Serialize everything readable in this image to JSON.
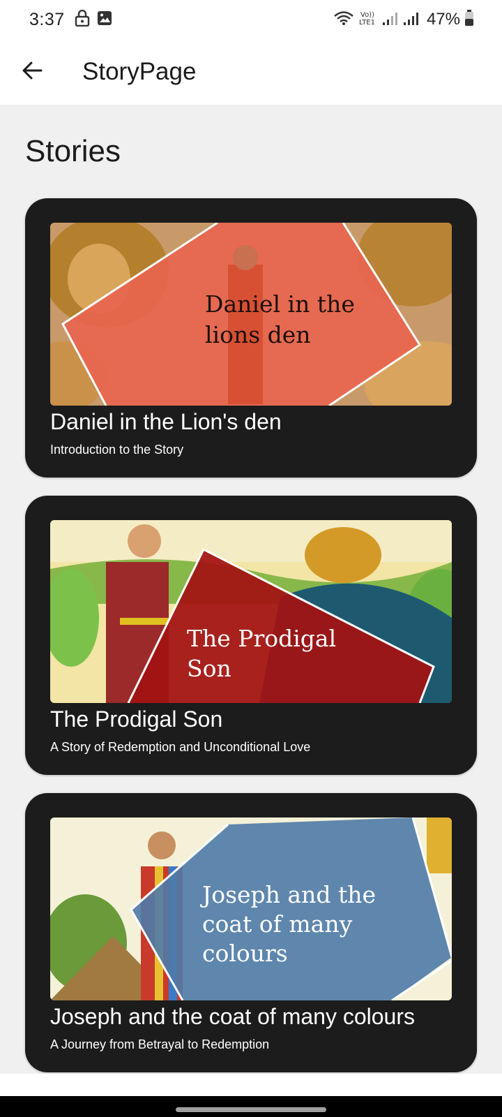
{
  "status_bar": {
    "time": "3:37",
    "battery": "47%",
    "icons": [
      "lock-icon",
      "image-icon",
      "wifi-icon",
      "volte-icon",
      "signal-icon",
      "battery-icon"
    ]
  },
  "app_bar": {
    "title": "StoryPage",
    "back_icon": "arrow-left-icon"
  },
  "section": {
    "title": "Stories"
  },
  "stories": [
    {
      "title": "Daniel in the Lion's den",
      "subtitle": "Introduction to the Story",
      "image_text_line1": "Daniel in the",
      "image_text_line2": "lions den",
      "accent": "#e8654f"
    },
    {
      "title": "The Prodigal Son",
      "subtitle": "A Story of Redemption and Unconditional Love",
      "image_text_line1": "The Prodigal",
      "image_text_line2": "Son",
      "accent": "#9e1414"
    },
    {
      "title": "Joseph and the coat of many colours",
      "subtitle": "A Journey from Betrayal to Redemption",
      "image_text_line1": "Joseph and the",
      "image_text_line2": "coat of many",
      "image_text_line3": "colours",
      "accent": "#4f7ba8"
    }
  ],
  "colors": {
    "card_bg": "#1c1c1c",
    "page_bg": "#f0f0f0",
    "appbar_bg": "#ffffff"
  }
}
